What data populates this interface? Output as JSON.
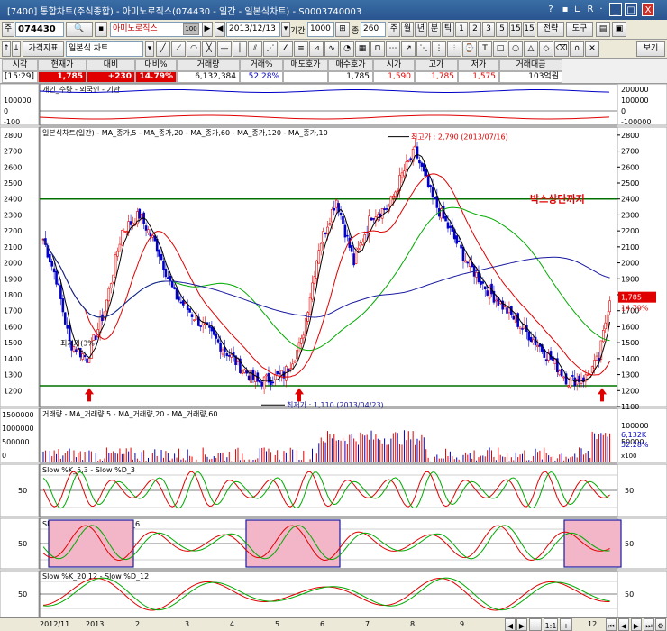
{
  "window": {
    "title": "[7400] 통합차트(주식종합) - 아미노로직스(074430 - 일간 - 일본식차트) - S0003740003",
    "icons": [
      "help-icon",
      "chart-icon",
      "link-icon",
      "r-icon",
      "menu-icon",
      "minimize-icon",
      "maximize-icon",
      "close-icon"
    ],
    "icon_chars": [
      "?",
      "▪",
      "⊔",
      "R",
      "·",
      "_",
      "□",
      "X"
    ]
  },
  "toolbar1": {
    "market": "주",
    "code": "074430",
    "search_icon": "🔍",
    "stock_name": "아미노로직스",
    "badge": "100",
    "date": "2013/12/13",
    "period_label": "기간",
    "period": "1000",
    "count": "260",
    "unit_label": "종",
    "units": [
      "주",
      "월",
      "년",
      "분",
      "틱",
      "1",
      "2",
      "3",
      "5",
      "15"
    ],
    "right_btns": [
      "전략",
      "도구",
      "보기"
    ]
  },
  "toolbar2": {
    "indicator_btn": "가격지표",
    "chart_type": "일본식 차트"
  },
  "quote": {
    "headers": [
      "시각",
      "현재가",
      "대비",
      "대비%",
      "거래량",
      "거래%",
      "매도호가",
      "매수호가",
      "시가",
      "고가",
      "저가",
      "거래대금"
    ],
    "values": [
      "[15:29]",
      "1,785",
      "+230",
      "14.79%",
      "6,132,384",
      "52.28%",
      "",
      "1,785",
      "1,590",
      "1,785",
      "1,575",
      "103억원"
    ]
  },
  "panes": {
    "investor": {
      "legend": "개인_수량 - 외국인 - 기관",
      "ticks": [
        "200000",
        "100000",
        "0",
        "-100000"
      ],
      "left_ticks": [
        "100000",
        "0",
        "-100"
      ]
    },
    "price": {
      "legend": "일본식차트(일간) - MA_종가,5 - MA_종가,20 - MA_종가,60 - MA_종가,120 - MA_종가,10",
      "ticks": [
        "2800",
        "2700",
        "2600",
        "2500",
        "2400",
        "2300",
        "2200",
        "2100",
        "2000",
        "1900",
        "1800",
        "1700",
        "1600",
        "1500",
        "1400",
        "1300",
        "1200",
        "1100"
      ],
      "left_ticks": [
        "2800",
        "2700",
        "2600",
        "2500",
        "2400",
        "2300",
        "2200",
        "2100",
        "2000",
        "1900",
        "1800",
        "1700",
        "1600",
        "1500",
        "1400",
        "1300",
        "1200"
      ],
      "max_note": "최고가 : 2,790 (2013/07/16)",
      "min_note": "최저가 : 1,110 (2013/04/23)",
      "box_label": "박스상단까지",
      "start_note": "최저가(3%)",
      "last_price": "1,785",
      "last_pct": "14.79%"
    },
    "volume": {
      "legend": "거래량 - MA_거래량,5 - MA_거래량,20 - MA_거래량,60",
      "ticks": [
        "100000",
        "50000"
      ],
      "left_ticks": [
        "1500000",
        "1000000",
        "500000",
        "0"
      ],
      "last_vol": "6,132K",
      "last_pct": "52.28%",
      "unit": "x100"
    },
    "stoch1": {
      "legend": "Slow %K_5,3 - Slow %D_3",
      "ticks": [
        "50"
      ],
      "left_ticks": [
        "50"
      ]
    },
    "stoch2": {
      "legend": "Slow %K_10,6 - Slow %D_6",
      "ticks": [
        "50"
      ],
      "left_ticks": [
        "50"
      ]
    },
    "stoch3": {
      "legend": "Slow %K_20,12 - Slow %D_12",
      "ticks": [
        "50"
      ],
      "left_ticks": [
        "50"
      ]
    }
  },
  "x_axis": {
    "labels": [
      "2012/11",
      "2013",
      "2",
      "3",
      "4",
      "5",
      "6",
      "7",
      "8",
      "9",
      "10",
      "11",
      "12"
    ]
  },
  "colors": {
    "red": "#e00000",
    "blue": "#0000c8",
    "green": "#00aa00",
    "navy": "#1a1aa0",
    "box": "#f2b6c8"
  }
}
